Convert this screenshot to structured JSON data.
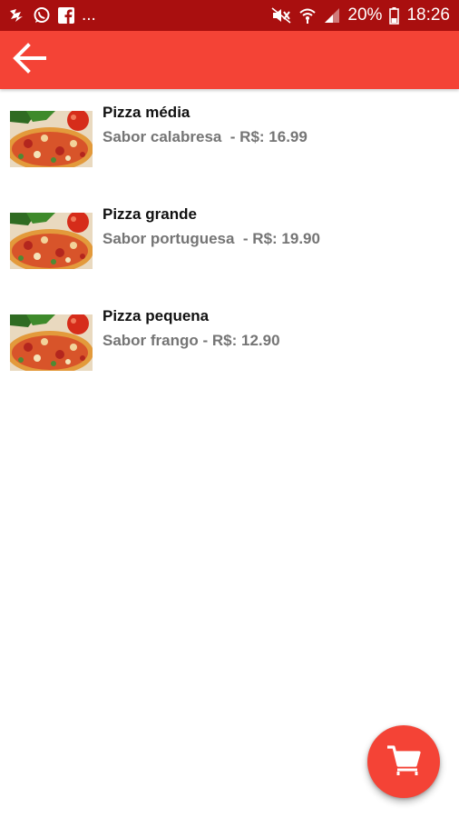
{
  "status_bar": {
    "left_icons": [
      "tencent-qq-icon",
      "whatsapp-icon",
      "facebook-icon"
    ],
    "overflow_text": "...",
    "right_icons": [
      "mute-icon",
      "wifi-icon",
      "signal-icon"
    ],
    "battery_text": "20%",
    "time": "18:26"
  },
  "app_bar": {
    "back_icon": "arrow-back-icon",
    "color": "#f44336",
    "status_color": "#a90f0f"
  },
  "products": [
    {
      "name": "Pizza média",
      "details": "Sabor calabresa  - R$: 16.99",
      "image": "pizza-image"
    },
    {
      "name": "Pizza grande",
      "details": "Sabor portuguesa  - R$: 19.90",
      "image": "pizza-image"
    },
    {
      "name": "Pizza pequena",
      "details": "Sabor frango - R$: 12.90",
      "image": "pizza-image"
    }
  ],
  "fab": {
    "icon": "shopping-cart-icon"
  }
}
